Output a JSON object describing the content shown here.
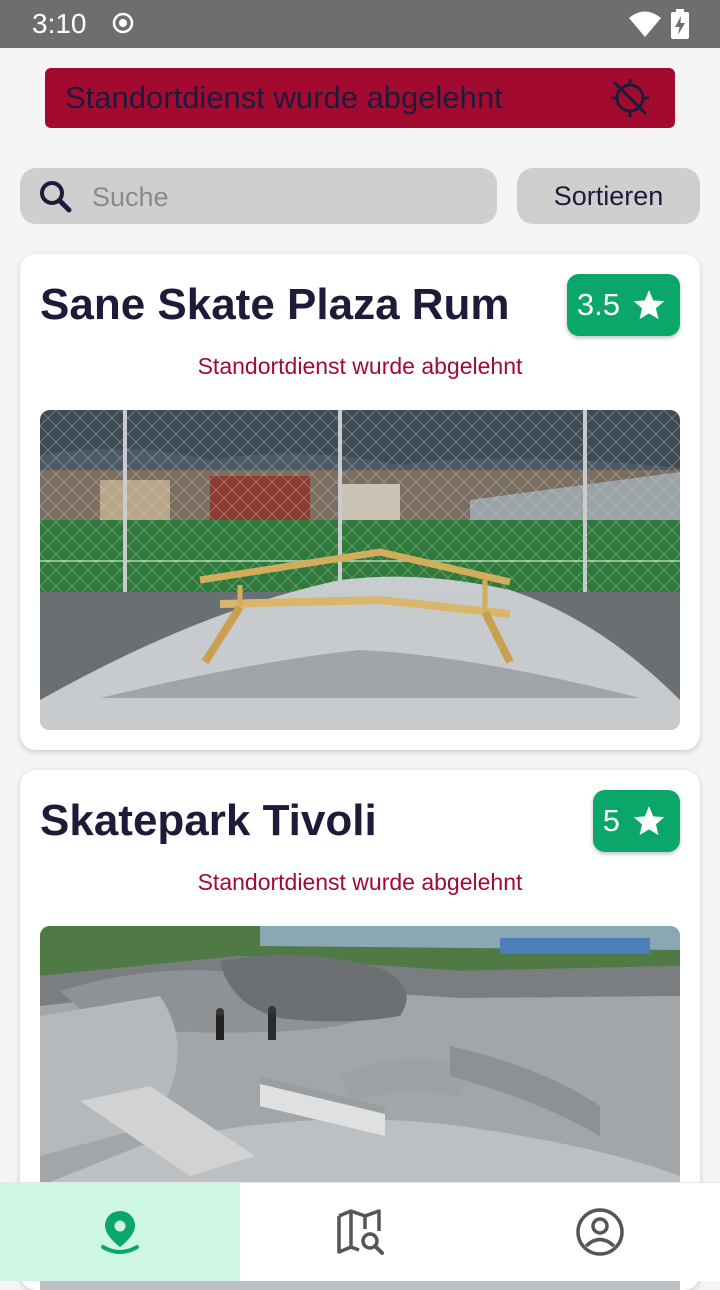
{
  "status_bar": {
    "time": "3:10",
    "icons": [
      "record-icon",
      "wifi-icon",
      "battery-charging-icon"
    ]
  },
  "banner": {
    "text": "Standortdienst wurde abgelehnt",
    "icon": "location-disabled-icon",
    "color": "#a30a30"
  },
  "search": {
    "placeholder": "Suche",
    "value": ""
  },
  "sort": {
    "label": "Sortieren"
  },
  "cards": [
    {
      "name": "Sane Skate Plaza Rum",
      "rating": "3.5",
      "location_text": "Standortdienst wurde abgelehnt",
      "image": "skate-plaza-rail-photo"
    },
    {
      "name": "Skatepark Tivoli",
      "rating": "5",
      "location_text": "Standortdienst wurde abgelehnt",
      "image": "skatepark-bowl-photo"
    }
  ],
  "bottom_nav": [
    {
      "id": "locations",
      "icon": "location-pin-icon",
      "active": true
    },
    {
      "id": "map",
      "icon": "map-search-icon",
      "active": false
    },
    {
      "id": "profile",
      "icon": "account-icon",
      "active": false
    }
  ],
  "colors": {
    "accent": "#0aa66a",
    "alert": "#a30a30",
    "text": "#1c1c3a"
  }
}
